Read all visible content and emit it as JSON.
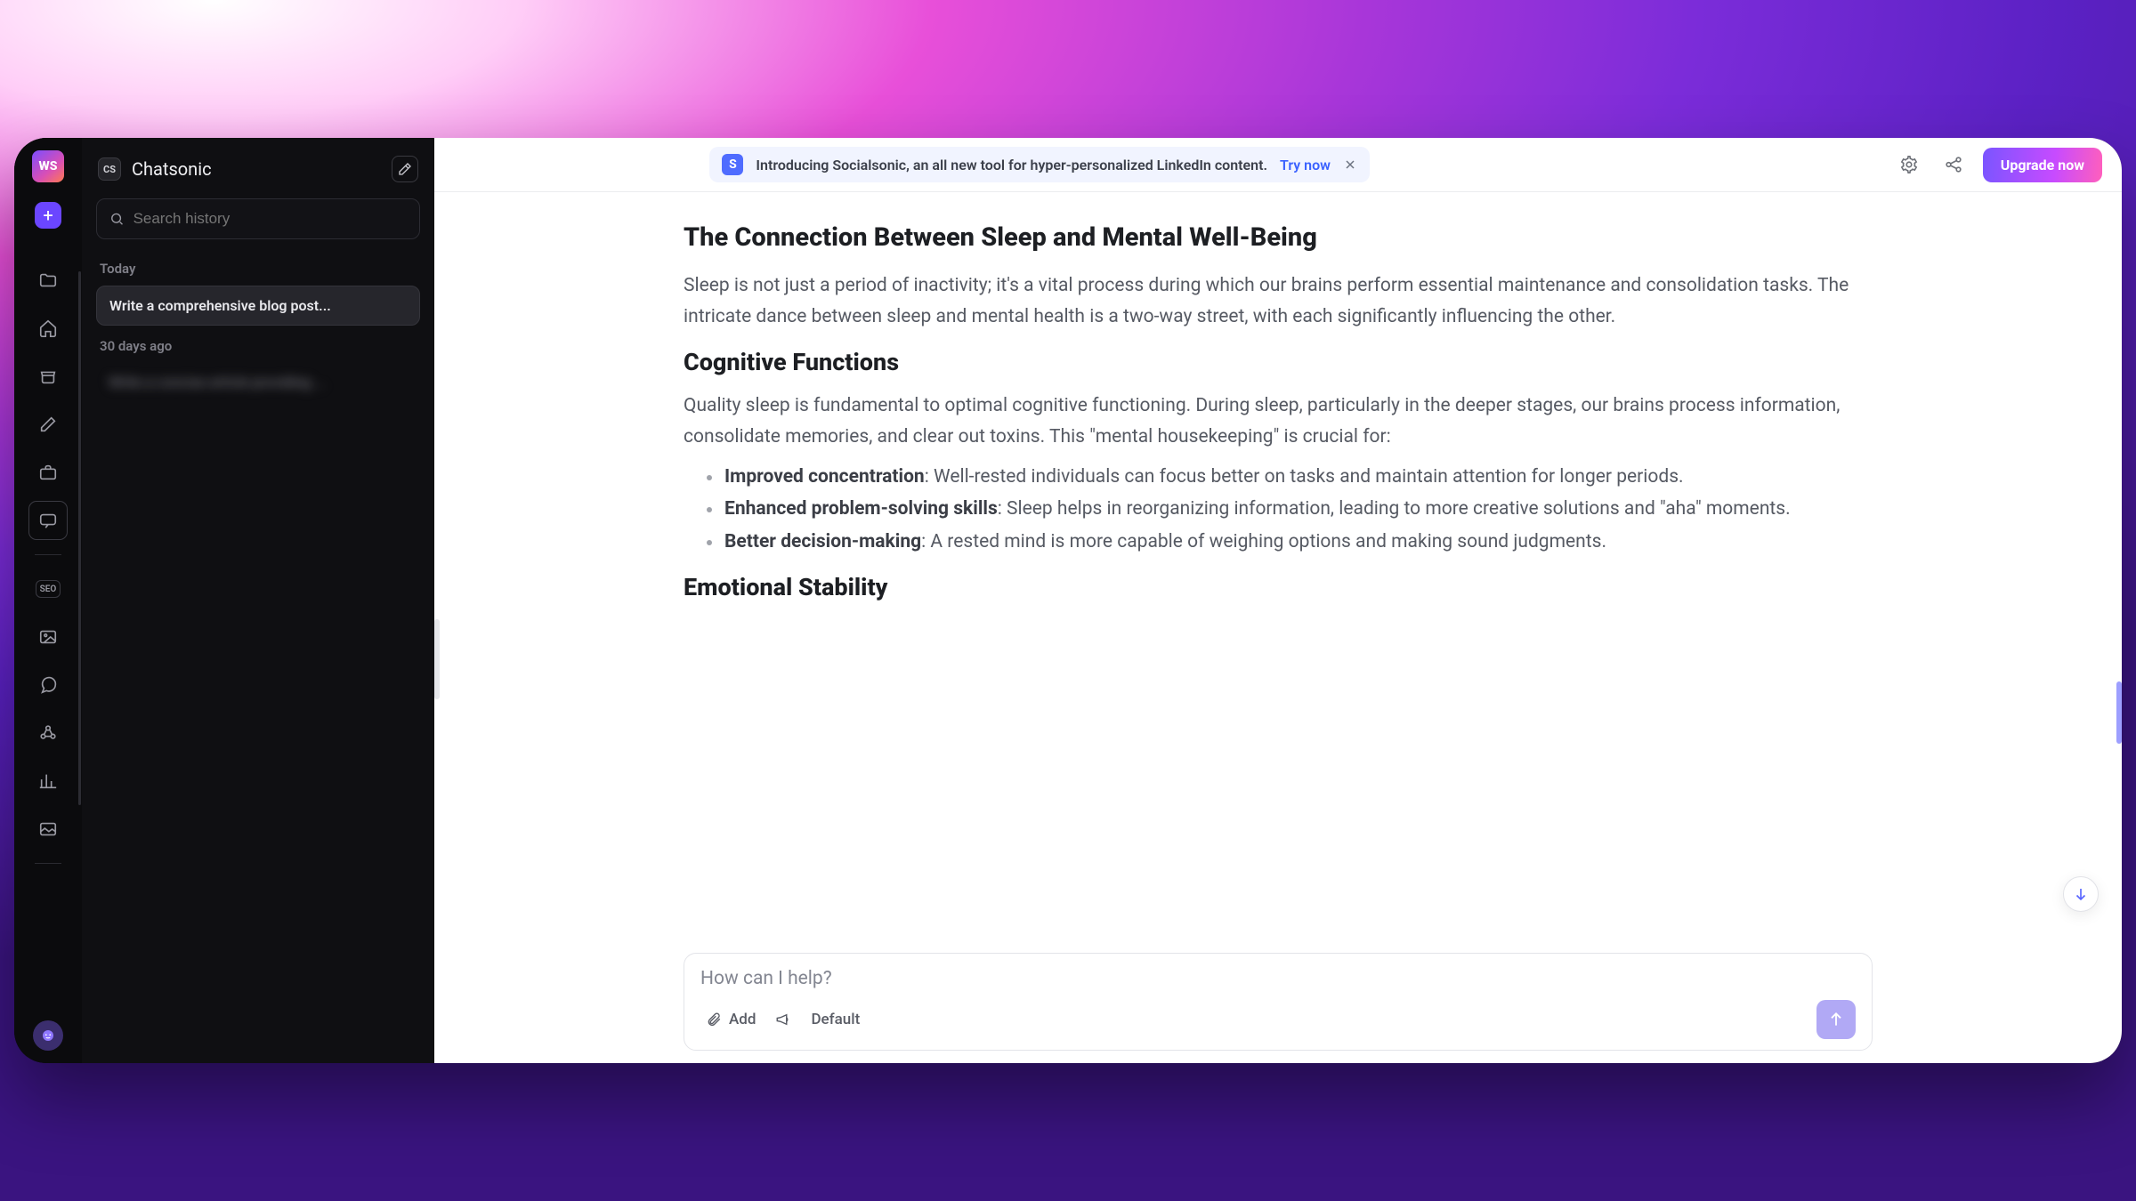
{
  "rail": {
    "logo_text": "WS"
  },
  "sidebar": {
    "cs_badge": "CS",
    "title": "Chatsonic",
    "search_placeholder": "Search history",
    "sections": {
      "today_label": "Today",
      "past_label": "30 days ago"
    },
    "history": {
      "today_item": "Write a comprehensive blog post...",
      "past_item": "Write a concise article providing ..."
    }
  },
  "topbar": {
    "banner_badge": "S",
    "banner_text": "Introducing Socialsonic, an all new tool for hyper-personalized LinkedIn content.",
    "banner_link": "Try now",
    "upgrade_label": "Upgrade now"
  },
  "article": {
    "h_connection": "The Connection Between Sleep and Mental Well-Being",
    "p_connection": "Sleep is not just a period of inactivity; it's a vital process during which our brains perform essential maintenance and consolidation tasks. The intricate dance between sleep and mental health is a two-way street, with each significantly influencing the other.",
    "h_cognitive": "Cognitive Functions",
    "p_cognitive": "Quality sleep is fundamental to optimal cognitive functioning. During sleep, particularly in the deeper stages, our brains process information, consolidate memories, and clear out toxins. This \"mental housekeeping\" is crucial for:",
    "bullets": [
      {
        "b": "Improved concentration",
        "t": ": Well-rested individuals can focus better on tasks and maintain attention for longer periods."
      },
      {
        "b": "Enhanced problem-solving skills",
        "t": ": Sleep helps in reorganizing information, leading to more creative solutions and \"aha\" moments."
      },
      {
        "b": "Better decision-making",
        "t": ": A rested mind is more capable of weighing options and making sound judgments."
      }
    ],
    "h_emotional": "Emotional Stability"
  },
  "composer": {
    "placeholder": "How can I help?",
    "add_label": "Add",
    "default_label": "Default"
  }
}
